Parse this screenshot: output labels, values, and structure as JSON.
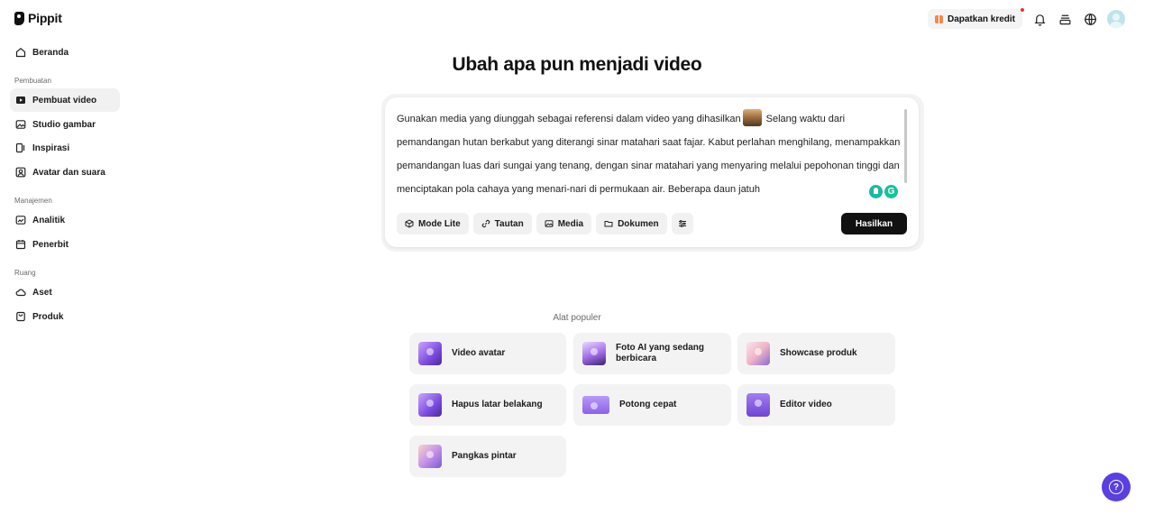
{
  "app": {
    "name": "Pippit"
  },
  "sidebar": {
    "items_top": [
      {
        "label": "Beranda",
        "icon": "home-icon"
      }
    ],
    "sections": [
      {
        "label": "Pembuatan",
        "items": [
          {
            "label": "Pembuat video",
            "icon": "video-maker-icon",
            "active": true
          },
          {
            "label": "Studio gambar",
            "icon": "image-studio-icon"
          },
          {
            "label": "Inspirasi",
            "icon": "inspiration-icon"
          },
          {
            "label": "Avatar dan suara",
            "icon": "avatar-voice-icon"
          }
        ]
      },
      {
        "label": "Manajemen",
        "items": [
          {
            "label": "Analitik",
            "icon": "analytics-icon"
          },
          {
            "label": "Penerbit",
            "icon": "calendar-icon"
          }
        ]
      },
      {
        "label": "Ruang",
        "items": [
          {
            "label": "Aset",
            "icon": "cloud-icon"
          },
          {
            "label": "Produk",
            "icon": "product-icon"
          }
        ]
      }
    ]
  },
  "topbar": {
    "credit_label": "Dapatkan kredit",
    "accent": "#e8323a"
  },
  "hero": {
    "title": "Ubah apa pun menjadi video"
  },
  "prompt": {
    "text_before": "Gunakan media yang diunggah sebagai referensi dalam video yang dihasilkan",
    "text_after": " Selang waktu dari pemandangan hutan berkabut yang diterangi sinar matahari saat fajar. Kabut perlahan menghilang, menampakkan pemandangan luas dari sungai yang tenang, dengan sinar matahari yang menyaring melalui pepohonan tinggi dan menciptakan pola cahaya yang menari-nari di permukaan air. Beberapa daun jatuh"
  },
  "tools": {
    "mode_lite": "Mode Lite",
    "link": "Tautan",
    "media": "Media",
    "document": "Dokumen",
    "generate": "Hasilkan"
  },
  "popular": {
    "label": "Alat populer",
    "items": [
      {
        "label": "Video avatar"
      },
      {
        "label": "Foto AI yang sedang berbicara"
      },
      {
        "label": "Showcase produk"
      },
      {
        "label": "Hapus latar belakang"
      },
      {
        "label": "Potong cepat"
      },
      {
        "label": "Editor video"
      },
      {
        "label": "Pangkas pintar"
      }
    ]
  },
  "colors": {
    "primary_button": "#111111",
    "help_button": "#5b3fe0"
  }
}
